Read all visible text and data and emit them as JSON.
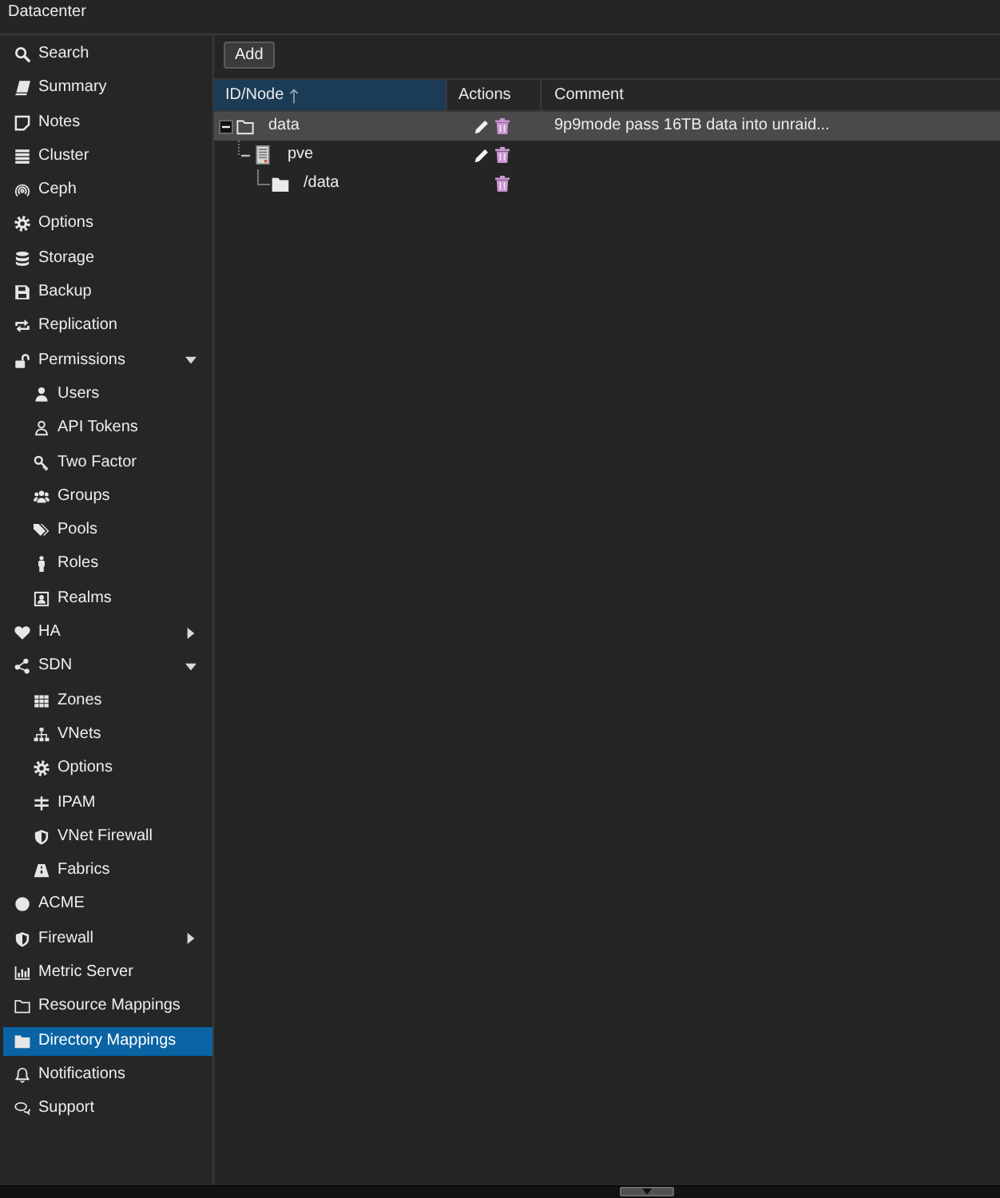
{
  "header": {
    "title": "Datacenter"
  },
  "sidebar": {
    "items": [
      {
        "label": "Search",
        "kind": "item",
        "selected": false
      },
      {
        "label": "Summary",
        "kind": "item",
        "selected": false
      },
      {
        "label": "Notes",
        "kind": "item",
        "selected": false
      },
      {
        "label": "Cluster",
        "kind": "item",
        "selected": false
      },
      {
        "label": "Ceph",
        "kind": "item",
        "selected": false
      },
      {
        "label": "Options",
        "kind": "item",
        "selected": false
      },
      {
        "label": "Storage",
        "kind": "item",
        "selected": false
      },
      {
        "label": "Backup",
        "kind": "item",
        "selected": false
      },
      {
        "label": "Replication",
        "kind": "item",
        "selected": false
      },
      {
        "label": "Permissions",
        "kind": "group",
        "expanded": true,
        "selected": false,
        "children": [
          {
            "label": "Users",
            "kind": "item",
            "selected": false
          },
          {
            "label": "API Tokens",
            "kind": "item",
            "selected": false
          },
          {
            "label": "Two Factor",
            "kind": "item",
            "selected": false
          },
          {
            "label": "Groups",
            "kind": "item",
            "selected": false
          },
          {
            "label": "Pools",
            "kind": "item",
            "selected": false
          },
          {
            "label": "Roles",
            "kind": "item",
            "selected": false
          },
          {
            "label": "Realms",
            "kind": "item",
            "selected": false
          }
        ]
      },
      {
        "label": "HA",
        "kind": "group",
        "expanded": false,
        "selected": false
      },
      {
        "label": "SDN",
        "kind": "group",
        "expanded": true,
        "selected": false,
        "children": [
          {
            "label": "Zones",
            "kind": "item",
            "selected": false
          },
          {
            "label": "VNets",
            "kind": "item",
            "selected": false
          },
          {
            "label": "Options",
            "kind": "item",
            "selected": false
          },
          {
            "label": "IPAM",
            "kind": "item",
            "selected": false
          },
          {
            "label": "VNet Firewall",
            "kind": "item",
            "selected": false
          },
          {
            "label": "Fabrics",
            "kind": "item",
            "selected": false
          }
        ]
      },
      {
        "label": "ACME",
        "kind": "item",
        "selected": false
      },
      {
        "label": "Firewall",
        "kind": "group",
        "expanded": false,
        "selected": false
      },
      {
        "label": "Metric Server",
        "kind": "item",
        "selected": false
      },
      {
        "label": "Resource Mappings",
        "kind": "item",
        "selected": false
      },
      {
        "label": "Directory Mappings",
        "kind": "item",
        "selected": true
      },
      {
        "label": "Notifications",
        "kind": "item",
        "selected": false
      },
      {
        "label": "Support",
        "kind": "item",
        "selected": false
      }
    ]
  },
  "toolbar": {
    "buttons": [
      "Add"
    ]
  },
  "grid": {
    "columns": [
      {
        "label": "ID/Node",
        "sorted": true,
        "ascending": true
      },
      {
        "label": "Actions",
        "sorted": false
      },
      {
        "label": "Comment",
        "sorted": false
      }
    ],
    "rows": [
      {
        "kind": "mapping",
        "id": "data",
        "comment": "9p9mode pass 16TB data into unraid...",
        "editable": true,
        "expanded": true,
        "selected": true,
        "children": [
          {
            "kind": "node",
            "id": "pve",
            "editable": true,
            "expanded": true,
            "selected": false,
            "children": [
              {
                "kind": "path",
                "id": "/data",
                "editable": false,
                "selected": false
              }
            ]
          }
        ]
      }
    ]
  }
}
